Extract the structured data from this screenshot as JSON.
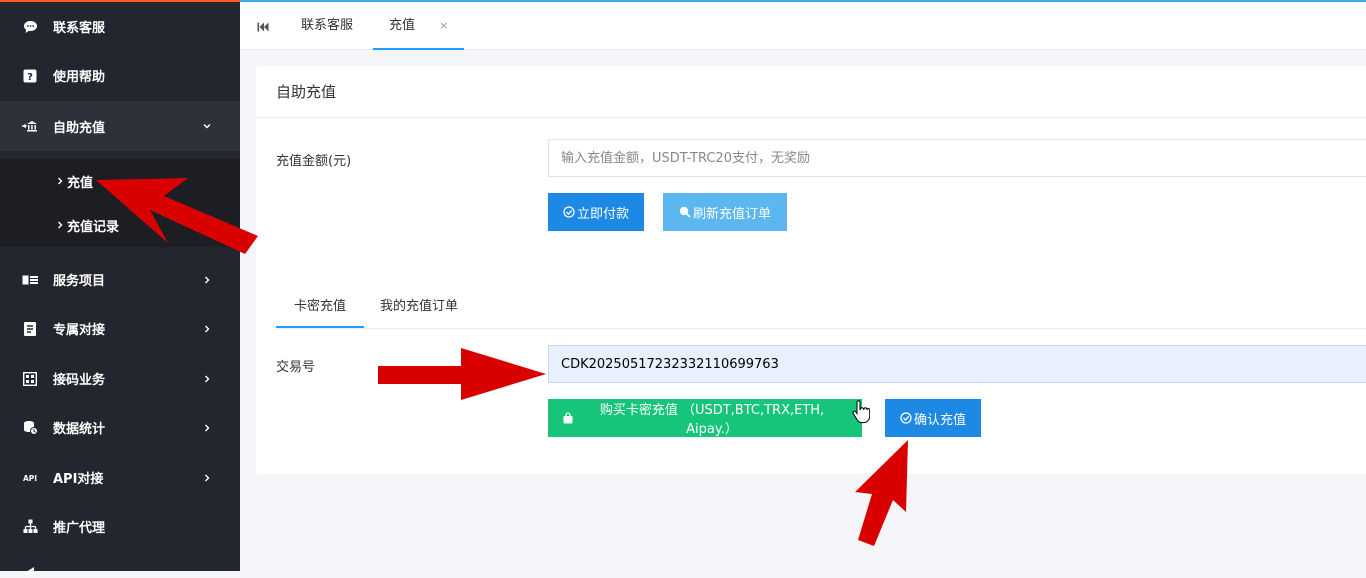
{
  "sidebar": {
    "items": [
      {
        "label": "联系客服",
        "icon": "chat-icon"
      },
      {
        "label": "使用帮助",
        "icon": "help-icon"
      },
      {
        "label": "自助充值",
        "icon": "recharge-bank-icon",
        "expanded": true,
        "children": [
          {
            "label": "充值"
          },
          {
            "label": "充值记录"
          }
        ]
      },
      {
        "label": "服务项目",
        "icon": "service-card-icon"
      },
      {
        "label": "专属对接",
        "icon": "dedicated-icon"
      },
      {
        "label": "接码业务",
        "icon": "sms-code-icon"
      },
      {
        "label": "数据统计",
        "icon": "database-icon"
      },
      {
        "label": "API对接",
        "icon": "api-icon"
      },
      {
        "label": "推广代理",
        "icon": "org-chart-icon"
      }
    ]
  },
  "tabs": [
    {
      "label": "联系客服"
    },
    {
      "label": "充值",
      "active": true,
      "close": "×"
    }
  ],
  "card": {
    "title": "自助充值",
    "amount_label": "充值金额(元)",
    "amount_placeholder": "输入充值金额，USDT-TRC20支付，无奖励",
    "pay_button": "立即付款",
    "refresh_button": "刷新充值订单",
    "subtabs": [
      {
        "label": "卡密充值",
        "active": true
      },
      {
        "label": "我的充值订单"
      }
    ],
    "txn_label": "交易号",
    "txn_value": "CDK20250517232332110699763",
    "buy_button": "购买卡密充值 （USDT,BTC,TRX,ETH, Aipay.）",
    "confirm_button": "确认充值"
  },
  "colors": {
    "sidebar_bg": "#23262e",
    "primary_blue": "#1e88e5",
    "light_blue": "#5cb6f0",
    "green": "#16c47a",
    "accent_top": "#40a9e8",
    "annotation_red": "#d90000"
  }
}
